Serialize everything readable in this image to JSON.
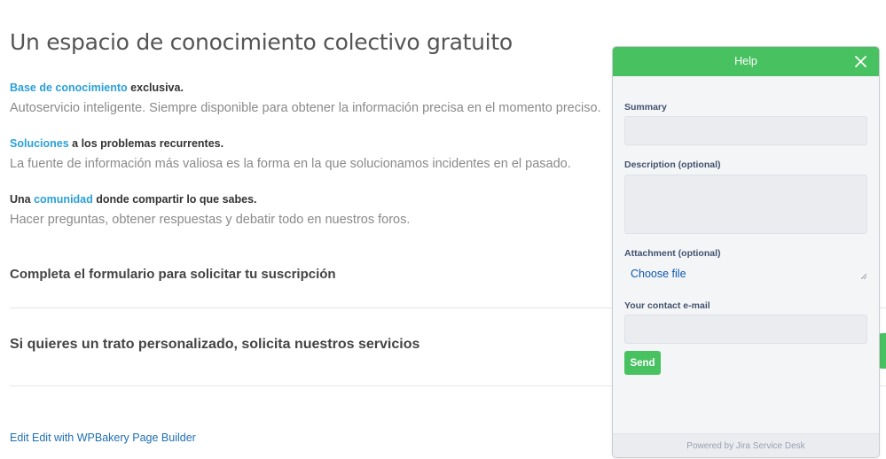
{
  "page": {
    "title": "Un espacio de conocimiento colectivo gratuito",
    "features": [
      {
        "link": "Base de conocimiento",
        "rest": " exclusiva.",
        "desc": "Autoservicio inteligente. Siempre disponible para obtener la información precisa en el momento preciso."
      },
      {
        "link": "Soluciones",
        "rest": " a los problemas recurrentes.",
        "desc": "La fuente de información más valiosa es la forma en la que solucionamos incidentes en el pasado."
      },
      {
        "prefix": "Una ",
        "link": "comunidad",
        "rest": " donde compartir lo que sabes.",
        "desc": "Hacer preguntas, obtener respuestas y debatir todo en nuestros foros."
      }
    ],
    "section1": "Completa el formulario para solicitar tu suscripción",
    "section2": "Si quieres un trato personalizado, solicita nuestros servicios",
    "edit_link": "Edit Edit with WPBakery Page Builder"
  },
  "help_widget": {
    "title": "Help",
    "summary_label": "Summary",
    "summary_value": "",
    "description_label": "Description (optional)",
    "description_value": "",
    "attachment_label": "Attachment (optional)",
    "choose_file": "Choose file",
    "email_label": "Your contact e-mail",
    "email_value": "",
    "send": "Send",
    "footer": "Powered by Jira Service Desk"
  },
  "colors": {
    "accent_green": "#48c161",
    "link_blue": "#2aa0d8"
  }
}
